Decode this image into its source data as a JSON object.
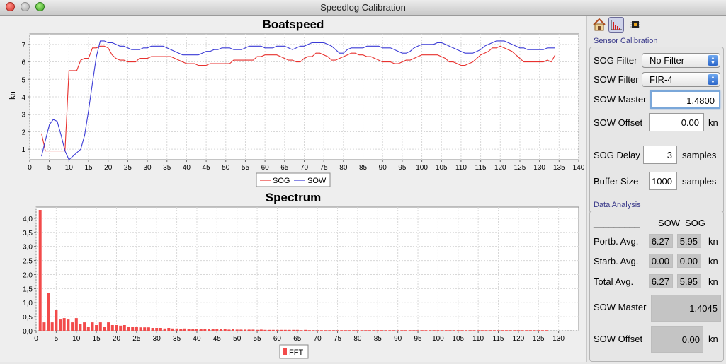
{
  "window": {
    "title": "Speedlog Calibration"
  },
  "toolbar": {
    "icons": [
      "home-icon",
      "chart-icon",
      "chip-icon"
    ]
  },
  "calibration": {
    "section_title": "Sensor Calibration",
    "sog_filter": {
      "label": "SOG Filter",
      "value": "No Filter"
    },
    "sow_filter": {
      "label": "SOW Filter",
      "value": "FIR-4"
    },
    "sow_master": {
      "label": "SOW Master",
      "value": "1.4800"
    },
    "sow_offset": {
      "label": "SOW Offset",
      "value": "0.00",
      "unit": "kn"
    },
    "sog_delay": {
      "label": "SOG Delay",
      "value": "3",
      "unit": "samples"
    },
    "buffer_size": {
      "label": "Buffer Size",
      "value": "1000",
      "unit": "samples"
    }
  },
  "analysis": {
    "section_title": "Data Analysis",
    "underline": "_________",
    "col_sow": "SOW",
    "col_sog": "SOG",
    "rows": [
      {
        "label": "Portb. Avg.",
        "sow": "6.27",
        "sog": "5.95",
        "unit": "kn"
      },
      {
        "label": "Starb. Avg.",
        "sow": "0.00",
        "sog": "0.00",
        "unit": "kn"
      },
      {
        "label": "Total Avg.",
        "sow": "6.27",
        "sog": "5.95",
        "unit": "kn"
      }
    ],
    "sow_master": {
      "label": "SOW Master",
      "value": "1.4045"
    },
    "sow_offset": {
      "label": "SOW Offset",
      "value": "0.00",
      "unit": "kn"
    }
  },
  "chart_data": [
    {
      "type": "line",
      "title": "Boatspeed",
      "ylabel": "kn",
      "xlim": [
        0,
        140
      ],
      "ylim": [
        0.4,
        7.6
      ],
      "xticks": [
        0,
        5,
        10,
        15,
        20,
        25,
        30,
        35,
        40,
        45,
        50,
        55,
        60,
        65,
        70,
        75,
        80,
        85,
        90,
        95,
        100,
        105,
        110,
        115,
        120,
        125,
        130,
        135,
        140
      ],
      "yticks": [
        1,
        2,
        3,
        4,
        5,
        6,
        7
      ],
      "grid": true,
      "legend": "bottom",
      "series": [
        {
          "name": "SOG",
          "color": "#e8322f",
          "x": [
            3,
            4,
            5,
            6,
            7,
            8,
            9,
            10,
            11,
            12,
            13,
            14,
            15,
            16,
            17,
            18,
            19,
            20,
            21,
            22,
            23,
            24,
            25,
            26,
            27,
            28,
            29,
            30,
            31,
            32,
            33,
            34,
            35,
            36,
            37,
            38,
            39,
            40,
            41,
            42,
            43,
            44,
            45,
            46,
            47,
            48,
            49,
            50,
            51,
            52,
            53,
            54,
            55,
            56,
            57,
            58,
            59,
            60,
            61,
            62,
            63,
            64,
            65,
            66,
            67,
            68,
            69,
            70,
            71,
            72,
            73,
            74,
            75,
            76,
            77,
            78,
            79,
            80,
            81,
            82,
            83,
            84,
            85,
            86,
            87,
            88,
            89,
            90,
            91,
            92,
            93,
            94,
            95,
            96,
            97,
            98,
            99,
            100,
            101,
            102,
            103,
            104,
            105,
            106,
            107,
            108,
            109,
            110,
            111,
            112,
            113,
            114,
            115,
            116,
            117,
            118,
            119,
            120,
            121,
            122,
            123,
            124,
            125,
            126,
            127,
            128,
            129,
            130,
            131,
            132,
            133,
            134
          ],
          "y": [
            1.9,
            0.9,
            0.9,
            0.9,
            0.9,
            0.9,
            0.9,
            5.5,
            5.5,
            5.5,
            6.1,
            6.2,
            6.2,
            6.8,
            6.8,
            6.9,
            6.9,
            6.8,
            6.4,
            6.2,
            6.1,
            6.1,
            6.0,
            6.0,
            6.0,
            6.2,
            6.2,
            6.2,
            6.3,
            6.3,
            6.3,
            6.3,
            6.3,
            6.3,
            6.2,
            6.1,
            6.0,
            5.9,
            5.9,
            5.9,
            5.8,
            5.8,
            5.8,
            5.9,
            5.9,
            5.9,
            5.9,
            5.9,
            5.9,
            6.1,
            6.1,
            6.1,
            6.1,
            6.1,
            6.1,
            6.3,
            6.3,
            6.4,
            6.4,
            6.4,
            6.4,
            6.3,
            6.2,
            6.1,
            6.1,
            6.0,
            6.0,
            6.2,
            6.3,
            6.3,
            6.5,
            6.5,
            6.4,
            6.3,
            6.1,
            6.1,
            6.2,
            6.3,
            6.4,
            6.5,
            6.5,
            6.4,
            6.4,
            6.3,
            6.3,
            6.2,
            6.1,
            6.0,
            6.0,
            6.0,
            5.9,
            5.9,
            6.0,
            6.1,
            6.1,
            6.2,
            6.3,
            6.4,
            6.4,
            6.4,
            6.4,
            6.4,
            6.3,
            6.2,
            6.0,
            6.0,
            5.9,
            5.8,
            5.8,
            5.9,
            6.0,
            6.2,
            6.4,
            6.5,
            6.6,
            6.8,
            6.8,
            6.9,
            6.8,
            6.7,
            6.6,
            6.4,
            6.2,
            6.0,
            6.0,
            6.0,
            6.0,
            6.0,
            6.0,
            6.1,
            6.0,
            6.4
          ]
        },
        {
          "name": "SOW",
          "color": "#3b3bd6",
          "x": [
            3,
            4,
            5,
            6,
            7,
            8,
            9,
            10,
            11,
            12,
            13,
            14,
            15,
            16,
            17,
            18,
            19,
            20,
            21,
            22,
            23,
            24,
            25,
            26,
            27,
            28,
            29,
            30,
            31,
            32,
            33,
            34,
            35,
            36,
            37,
            38,
            39,
            40,
            41,
            42,
            43,
            44,
            45,
            46,
            47,
            48,
            49,
            50,
            51,
            52,
            53,
            54,
            55,
            56,
            57,
            58,
            59,
            60,
            61,
            62,
            63,
            64,
            65,
            66,
            67,
            68,
            69,
            70,
            71,
            72,
            73,
            74,
            75,
            76,
            77,
            78,
            79,
            80,
            81,
            82,
            83,
            84,
            85,
            86,
            87,
            88,
            89,
            90,
            91,
            92,
            93,
            94,
            95,
            96,
            97,
            98,
            99,
            100,
            101,
            102,
            103,
            104,
            105,
            106,
            107,
            108,
            109,
            110,
            111,
            112,
            113,
            114,
            115,
            116,
            117,
            118,
            119,
            120,
            121,
            122,
            123,
            124,
            125,
            126,
            127,
            128,
            129,
            130,
            131,
            132,
            133,
            134
          ],
          "y": [
            0.6,
            1.5,
            2.4,
            2.7,
            2.6,
            1.8,
            0.9,
            0.4,
            0.6,
            0.8,
            1.0,
            1.8,
            3.2,
            4.8,
            6.3,
            7.2,
            7.2,
            7.1,
            7.1,
            7.0,
            6.9,
            6.9,
            6.8,
            6.7,
            6.7,
            6.7,
            6.8,
            6.8,
            6.9,
            6.9,
            6.9,
            6.9,
            6.8,
            6.7,
            6.6,
            6.5,
            6.4,
            6.4,
            6.4,
            6.4,
            6.4,
            6.5,
            6.6,
            6.6,
            6.7,
            6.7,
            6.8,
            6.8,
            6.8,
            6.7,
            6.7,
            6.7,
            6.8,
            6.9,
            6.9,
            6.9,
            6.9,
            6.8,
            6.8,
            6.8,
            6.9,
            6.9,
            6.9,
            6.8,
            6.7,
            6.8,
            6.9,
            6.9,
            7.0,
            7.1,
            7.1,
            7.1,
            7.1,
            7.0,
            6.9,
            6.7,
            6.5,
            6.5,
            6.7,
            6.8,
            6.8,
            6.8,
            6.8,
            6.9,
            6.9,
            6.9,
            6.9,
            6.8,
            6.8,
            6.8,
            6.7,
            6.6,
            6.5,
            6.5,
            6.6,
            6.8,
            6.9,
            7.0,
            7.0,
            7.0,
            7.0,
            7.1,
            7.1,
            7.0,
            6.9,
            6.8,
            6.7,
            6.6,
            6.5,
            6.5,
            6.5,
            6.6,
            6.7,
            6.9,
            7.0,
            7.1,
            7.2,
            7.2,
            7.2,
            7.1,
            7.0,
            6.9,
            6.8,
            6.8,
            6.7,
            6.7,
            6.7,
            6.7,
            6.7,
            6.8,
            6.8,
            6.8
          ]
        }
      ]
    },
    {
      "type": "bar",
      "title": "Spectrum",
      "xlim": [
        0,
        135
      ],
      "ylim": [
        0,
        4.4
      ],
      "xticks": [
        0,
        5,
        10,
        15,
        20,
        25,
        30,
        35,
        40,
        45,
        50,
        55,
        60,
        65,
        70,
        75,
        80,
        85,
        90,
        95,
        100,
        105,
        110,
        115,
        120,
        125,
        130
      ],
      "yticks": [
        "0,0",
        "0,5",
        "1,0",
        "1,5",
        "2,0",
        "2,5",
        "3,0",
        "3,5",
        "4,0"
      ],
      "grid": true,
      "legend": "bottom",
      "series": [
        {
          "name": "FFT",
          "color": "#f24b4b",
          "x": [
            1,
            2,
            3,
            4,
            5,
            6,
            7,
            8,
            9,
            10,
            11,
            12,
            13,
            14,
            15,
            16,
            17,
            18,
            19,
            20,
            21,
            22,
            23,
            24,
            25,
            26,
            27,
            28,
            29,
            30,
            31,
            32,
            33,
            34,
            35,
            36,
            37,
            38,
            39,
            40,
            41,
            42,
            43,
            44,
            45,
            46,
            47,
            48,
            49,
            50,
            51,
            52,
            53,
            54,
            55,
            56,
            57,
            58,
            59,
            60,
            61,
            62,
            63,
            64,
            65,
            66,
            67,
            68,
            69,
            70,
            71,
            72,
            73,
            74,
            75,
            76,
            77,
            78,
            79,
            80,
            81,
            82,
            83,
            84,
            85,
            86,
            87,
            88,
            89,
            90,
            91,
            92,
            93,
            94,
            95,
            96,
            97,
            98,
            99,
            100,
            101,
            102,
            103,
            104,
            105,
            106,
            107,
            108,
            109,
            110,
            111,
            112,
            113,
            114,
            115,
            116,
            117,
            118,
            119,
            120,
            121,
            122,
            123,
            124,
            125,
            126,
            127
          ],
          "y": [
            4.3,
            0.3,
            1.35,
            0.3,
            0.75,
            0.4,
            0.45,
            0.4,
            0.3,
            0.45,
            0.25,
            0.3,
            0.15,
            0.3,
            0.2,
            0.3,
            0.15,
            0.3,
            0.2,
            0.2,
            0.18,
            0.2,
            0.15,
            0.15,
            0.15,
            0.12,
            0.12,
            0.12,
            0.1,
            0.1,
            0.1,
            0.08,
            0.1,
            0.08,
            0.08,
            0.07,
            0.08,
            0.06,
            0.07,
            0.06,
            0.06,
            0.06,
            0.05,
            0.06,
            0.05,
            0.05,
            0.05,
            0.04,
            0.05,
            0.04,
            0.04,
            0.04,
            0.04,
            0.04,
            0.03,
            0.04,
            0.03,
            0.03,
            0.03,
            0.03,
            0.03,
            0.03,
            0.03,
            0.03,
            0.03,
            0.02,
            0.03,
            0.02,
            0.02,
            0.02,
            0.02,
            0.02,
            0.02,
            0.02,
            0.02,
            0.02,
            0.02,
            0.02,
            0.02,
            0.02,
            0.02,
            0.02,
            0.02,
            0.02,
            0.02,
            0.02,
            0.02,
            0.02,
            0.02,
            0.02,
            0.02,
            0.02,
            0.02,
            0.02,
            0.02,
            0.02,
            0.02,
            0.02,
            0.02,
            0.02,
            0.02,
            0.02,
            0.02,
            0.02,
            0.02,
            0.02,
            0.02,
            0.02,
            0.02,
            0.02,
            0.02,
            0.02,
            0.02,
            0.02,
            0.02,
            0.02,
            0.02,
            0.02,
            0.02,
            0.02,
            0.02,
            0.02,
            0.02,
            0.02,
            0.02,
            0.02,
            0.02
          ]
        }
      ]
    }
  ]
}
